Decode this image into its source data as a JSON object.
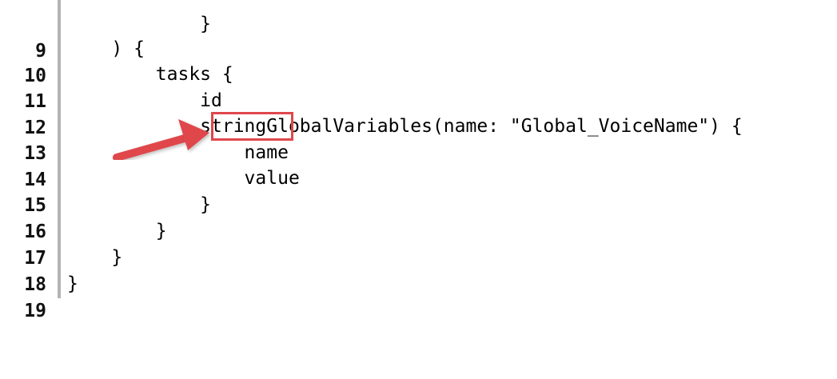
{
  "editor": {
    "lines": [
      {
        "number": "9",
        "code": "            }"
      },
      {
        "number": "10",
        "code": "    ) {"
      },
      {
        "number": "11",
        "code": "        tasks {"
      },
      {
        "number": "12",
        "code": "            id"
      },
      {
        "number": "13",
        "code": "            stringGlobalVariables(name: \"Global_VoiceName\") {"
      },
      {
        "number": "14",
        "code": "                name"
      },
      {
        "number": "15",
        "code": "                value"
      },
      {
        "number": "16",
        "code": "            }"
      },
      {
        "number": "17",
        "code": "        }"
      },
      {
        "number": "18",
        "code": "    }"
      },
      {
        "number": "19",
        "code": "}"
      }
    ]
  },
  "annotation": {
    "highlight_color": "#e0474c",
    "arrow_color": "#e0474c",
    "highlighted_text": "string"
  }
}
